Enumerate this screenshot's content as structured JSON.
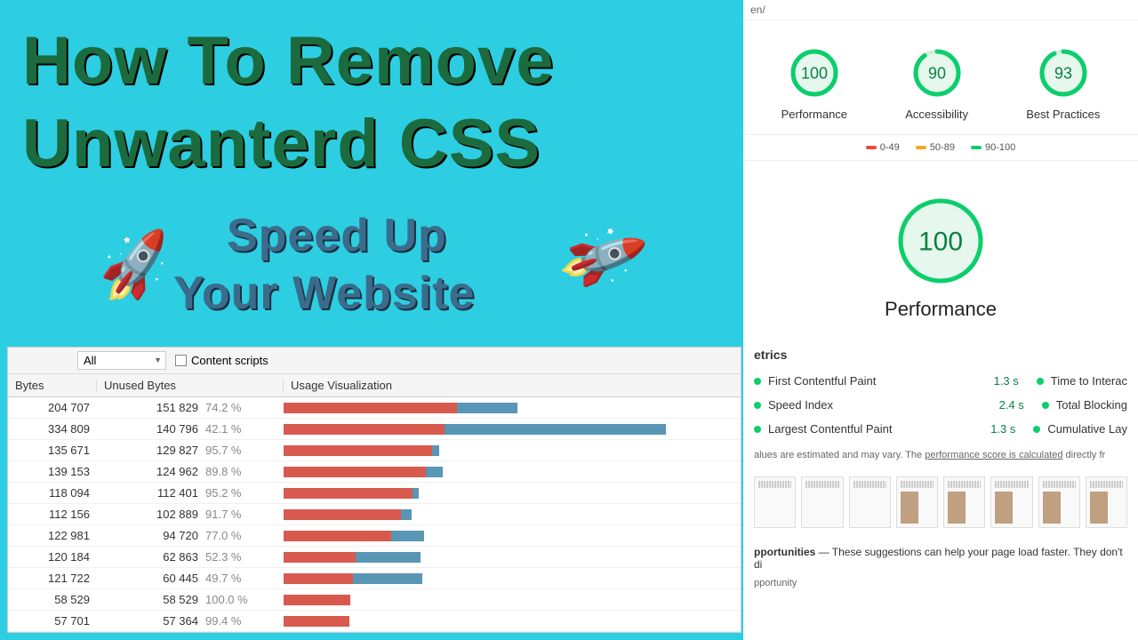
{
  "headline": {
    "line1": "How To Remove",
    "line2": "Unwanterd CSS",
    "sub1": "Speed Up",
    "sub2": "Your Website"
  },
  "coverage": {
    "filter_label": "All",
    "checkbox_label": "Content scripts",
    "headers": {
      "bytes": "Bytes",
      "unused": "Unused Bytes",
      "usage": "Usage Visualization"
    },
    "rows": [
      {
        "bytes": "204 707",
        "unused": "151 829",
        "pct": "74.2 %",
        "total_w": 52,
        "unused_w": 38.6
      },
      {
        "bytes": "334 809",
        "unused": "140 796",
        "pct": "42.1 %",
        "total_w": 85,
        "unused_w": 35.8
      },
      {
        "bytes": "135 671",
        "unused": "129 827",
        "pct": "95.7 %",
        "total_w": 34.5,
        "unused_w": 33.0
      },
      {
        "bytes": "139 153",
        "unused": "124 962",
        "pct": "89.8 %",
        "total_w": 35.3,
        "unused_w": 31.7
      },
      {
        "bytes": "118 094",
        "unused": "112 401",
        "pct": "95.2 %",
        "total_w": 30.0,
        "unused_w": 28.6
      },
      {
        "bytes": "112 156",
        "unused": "102 889",
        "pct": "91.7 %",
        "total_w": 28.5,
        "unused_w": 26.1
      },
      {
        "bytes": "122 981",
        "unused": "94 720",
        "pct": "77.0 %",
        "total_w": 31.2,
        "unused_w": 24.0
      },
      {
        "bytes": "120 184",
        "unused": "62 863",
        "pct": "52.3 %",
        "total_w": 30.5,
        "unused_w": 16.0
      },
      {
        "bytes": "121 722",
        "unused": "60 445",
        "pct": "49.7 %",
        "total_w": 30.9,
        "unused_w": 15.4
      },
      {
        "bytes": "58 529",
        "unused": "58 529",
        "pct": "100.0 %",
        "total_w": 14.9,
        "unused_w": 14.9
      },
      {
        "bytes": "57 701",
        "unused": "57 364",
        "pct": "99.4 %",
        "total_w": 14.7,
        "unused_w": 14.6
      }
    ]
  },
  "lighthouse": {
    "url_suffix": "en/",
    "scores": [
      {
        "value": 100,
        "label": "Performance",
        "color": "#0CCE6B",
        "pct": 100
      },
      {
        "value": 90,
        "label": "Accessibility",
        "color": "#0CCE6B",
        "pct": 90
      },
      {
        "value": 93,
        "label": "Best Practices",
        "color": "#0CCE6B",
        "pct": 93
      }
    ],
    "legend": {
      "low": "0-49",
      "mid": "50-89",
      "high": "90-100"
    },
    "big": {
      "value": 100,
      "label": "Performance"
    },
    "metrics_head": "etrics",
    "metrics": [
      {
        "name": "First Contentful Paint",
        "val": "1.3 s",
        "name2": "Time to Interac"
      },
      {
        "name": "Speed Index",
        "val": "2.4 s",
        "name2": "Total Blocking"
      },
      {
        "name": "Largest Contentful Paint",
        "val": "1.3 s",
        "name2": "Cumulative Lay"
      }
    ],
    "note_pre": "alues are estimated and may vary. The ",
    "note_u": "performance score is calculated",
    "note_post": " directly fr",
    "opp_label": "pportunities",
    "opp_text": " — These suggestions can help your page load faster. They don't di",
    "opp_sub": "pportunity"
  }
}
